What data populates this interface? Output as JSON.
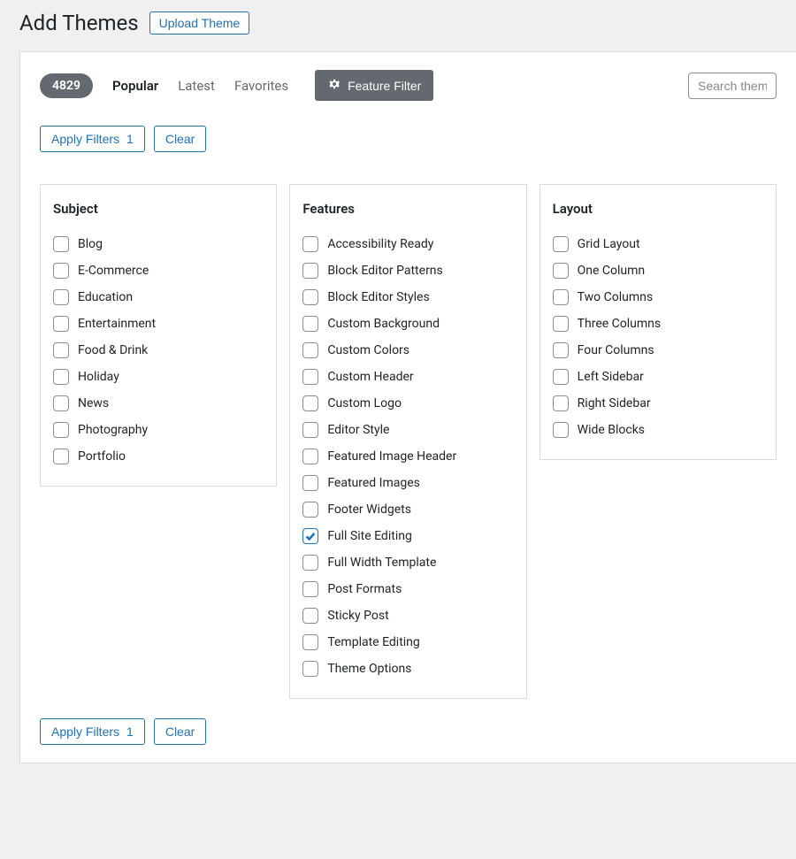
{
  "header": {
    "title": "Add Themes",
    "upload_label": "Upload Theme"
  },
  "tabs": {
    "count": "4829",
    "popular": "Popular",
    "latest": "Latest",
    "favorites": "Favorites",
    "feature_filter": "Feature Filter"
  },
  "search": {
    "placeholder": "Search them"
  },
  "actions": {
    "apply": "Apply Filters",
    "apply_count": "1",
    "clear": "Clear"
  },
  "columns": {
    "subject": {
      "title": "Subject",
      "items": [
        {
          "label": "Blog",
          "checked": false
        },
        {
          "label": "E-Commerce",
          "checked": false
        },
        {
          "label": "Education",
          "checked": false
        },
        {
          "label": "Entertainment",
          "checked": false
        },
        {
          "label": "Food & Drink",
          "checked": false
        },
        {
          "label": "Holiday",
          "checked": false
        },
        {
          "label": "News",
          "checked": false
        },
        {
          "label": "Photography",
          "checked": false
        },
        {
          "label": "Portfolio",
          "checked": false
        }
      ]
    },
    "features": {
      "title": "Features",
      "items": [
        {
          "label": "Accessibility Ready",
          "checked": false
        },
        {
          "label": "Block Editor Patterns",
          "checked": false
        },
        {
          "label": "Block Editor Styles",
          "checked": false
        },
        {
          "label": "Custom Background",
          "checked": false
        },
        {
          "label": "Custom Colors",
          "checked": false
        },
        {
          "label": "Custom Header",
          "checked": false
        },
        {
          "label": "Custom Logo",
          "checked": false
        },
        {
          "label": "Editor Style",
          "checked": false
        },
        {
          "label": "Featured Image Header",
          "checked": false
        },
        {
          "label": "Featured Images",
          "checked": false
        },
        {
          "label": "Footer Widgets",
          "checked": false
        },
        {
          "label": "Full Site Editing",
          "checked": true
        },
        {
          "label": "Full Width Template",
          "checked": false
        },
        {
          "label": "Post Formats",
          "checked": false
        },
        {
          "label": "Sticky Post",
          "checked": false
        },
        {
          "label": "Template Editing",
          "checked": false
        },
        {
          "label": "Theme Options",
          "checked": false
        }
      ]
    },
    "layout": {
      "title": "Layout",
      "items": [
        {
          "label": "Grid Layout",
          "checked": false
        },
        {
          "label": "One Column",
          "checked": false
        },
        {
          "label": "Two Columns",
          "checked": false
        },
        {
          "label": "Three Columns",
          "checked": false
        },
        {
          "label": "Four Columns",
          "checked": false
        },
        {
          "label": "Left Sidebar",
          "checked": false
        },
        {
          "label": "Right Sidebar",
          "checked": false
        },
        {
          "label": "Wide Blocks",
          "checked": false
        }
      ]
    }
  }
}
